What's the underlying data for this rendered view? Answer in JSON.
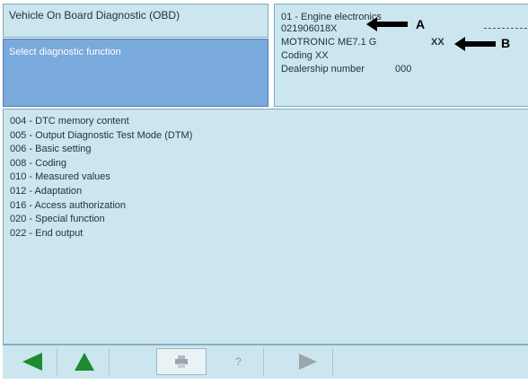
{
  "header": {
    "title": "Vehicle On Board Diagnostic (OBD)",
    "select_label": "Select diagnostic function"
  },
  "info": {
    "system": "01 - Engine electronics",
    "part_number": "021906018X",
    "component": "MOTRONIC ME7.1 G",
    "version": "XX",
    "coding": "Coding XX",
    "dealership_label": "Dealership number",
    "dealership_value": "000",
    "callout_a": "A",
    "callout_b": "B"
  },
  "functions": [
    {
      "label": "004 - DTC memory content"
    },
    {
      "label": "005 - Output Diagnostic Test Mode (DTM)"
    },
    {
      "label": "006 - Basic setting"
    },
    {
      "label": "008 - Coding"
    },
    {
      "label": "010 - Measured values"
    },
    {
      "label": "012 - Adaptation"
    },
    {
      "label": "016 - Access authorization"
    },
    {
      "label": "020 - Special function"
    },
    {
      "label": "022 - End output"
    }
  ],
  "toolbar": {
    "back_icon": "back-arrow-icon",
    "up_icon": "up-arrow-icon",
    "print_icon": "print-icon",
    "help_label": "?",
    "next_icon": "forward-arrow-icon",
    "accent_green": "#1e8a2e",
    "disabled_gray": "#9aa6ac"
  },
  "colors": {
    "panel_bg": "#cbe6ee",
    "select_bg": "#7aa9dc"
  }
}
